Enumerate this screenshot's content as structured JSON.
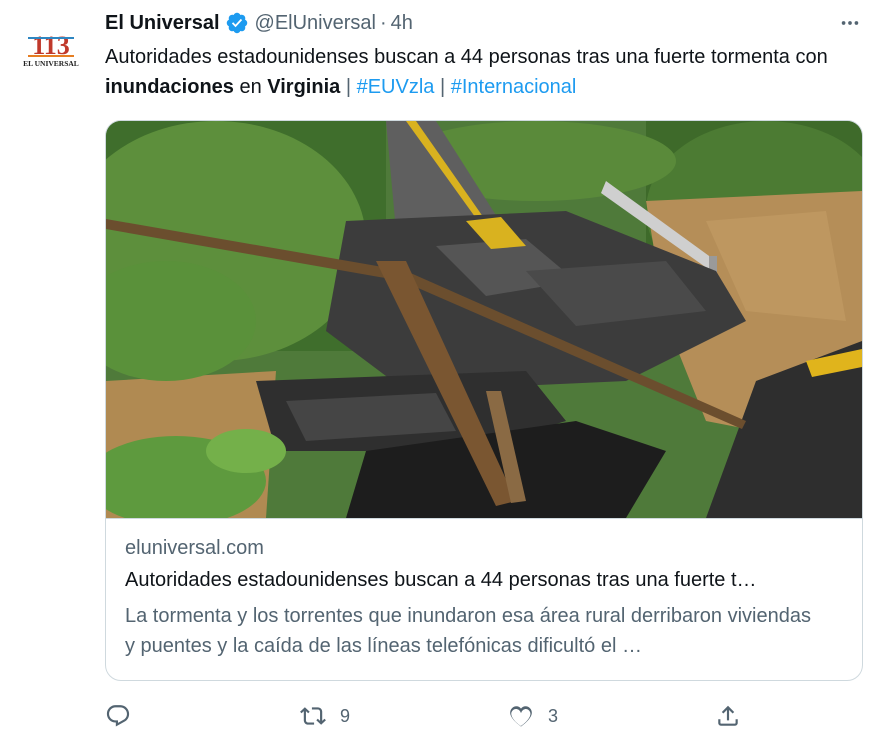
{
  "author": {
    "name": "El Universal",
    "handle": "@ElUniversal",
    "separator": "·",
    "time": "4h",
    "avatar_text_top": "113",
    "avatar_text_bottom": "EL UNIVERSAL"
  },
  "tweet": {
    "text_1": "Autoridades estadounidenses buscan a 44 personas tras una fuerte tormenta con ",
    "bold_1": "inundaciones",
    "text_2": " en ",
    "bold_2": "Virginia",
    "sep_1": " | ",
    "hashtag_1": "#EUVzla",
    "sep_2": " | ",
    "hashtag_2": "#Internacional"
  },
  "card": {
    "image_icon": "flooded-collapsed-road-photo",
    "domain": "eluniversal.com",
    "title": "Autoridades estadounidenses buscan a 44 personas tras una fuerte t…",
    "description": "La tormenta y los torrentes que inundaron esa área rural derribaron viviendas y puentes y la caída de las líneas telefónicas dificultó el …"
  },
  "actions": {
    "reply_icon": "reply-icon",
    "retweet_icon": "retweet-icon",
    "retweet_count": "9",
    "like_icon": "heart-icon",
    "like_count": "3",
    "share_icon": "share-icon"
  },
  "colors": {
    "accent": "#1d9bf0",
    "text": "#0f1419",
    "secondary": "#536471",
    "border": "#cfd9de"
  }
}
